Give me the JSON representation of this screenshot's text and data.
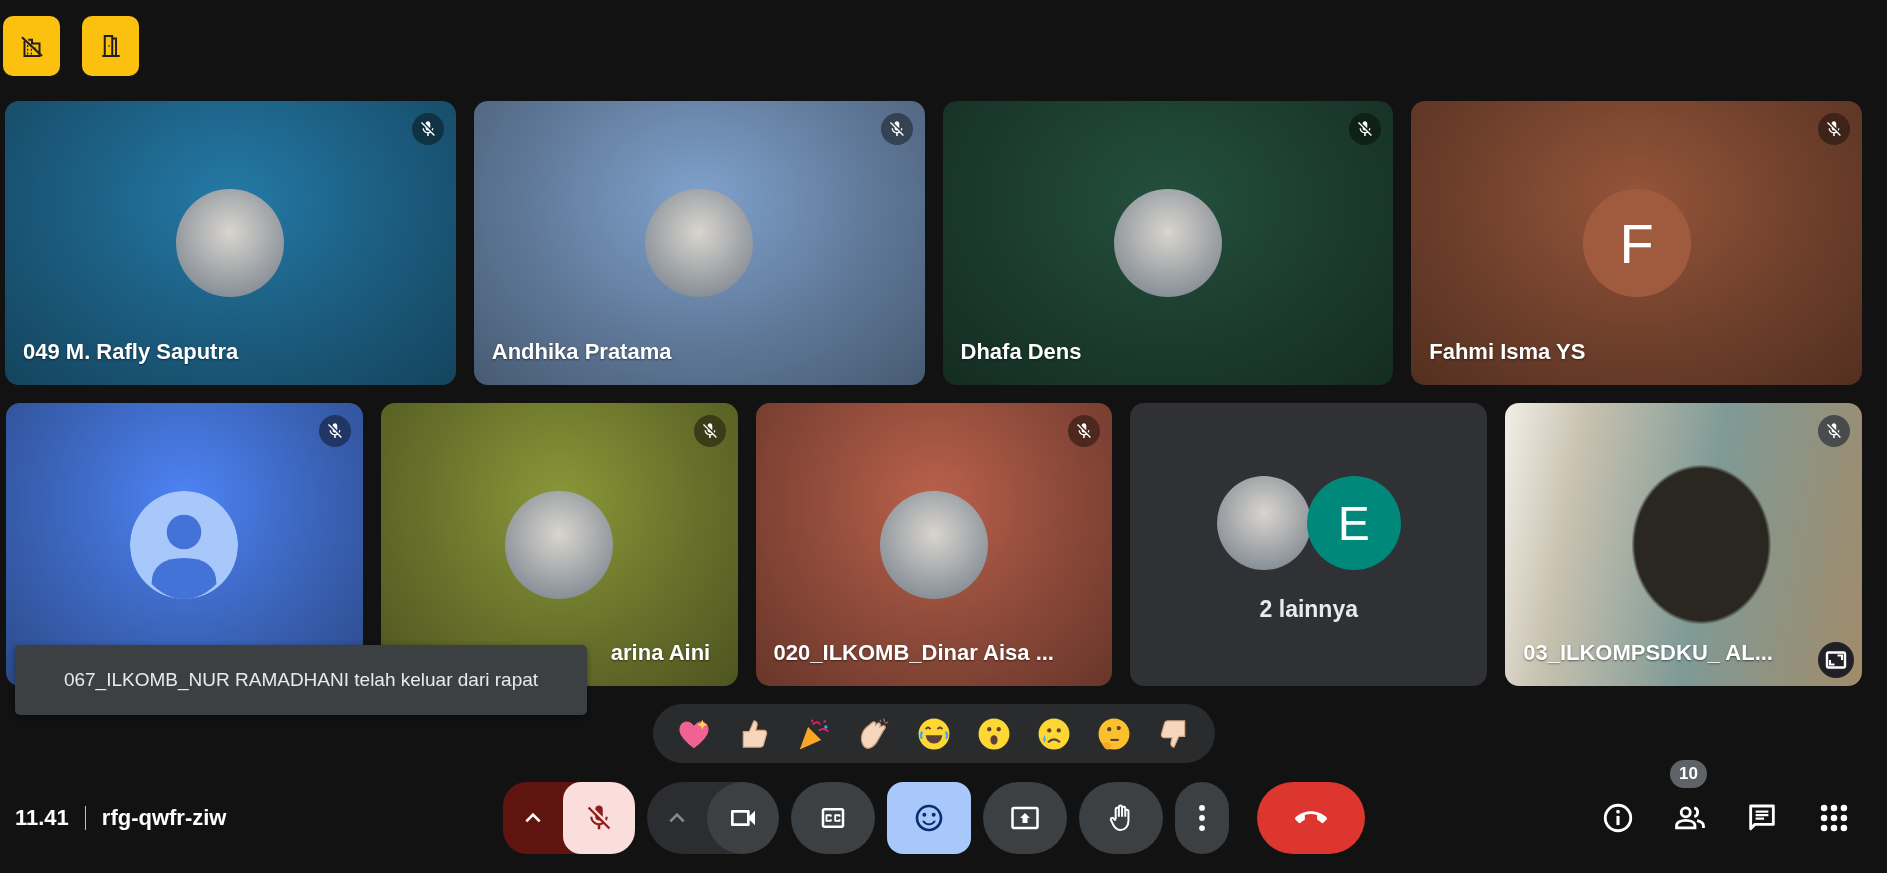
{
  "top_buttons": [
    {
      "kind": "no-building"
    },
    {
      "kind": "door"
    }
  ],
  "tiles": [
    {
      "kind": "photo",
      "name": "049 M. Rafly Saputra",
      "muted": true,
      "color": "#1b5a7c"
    },
    {
      "kind": "photo",
      "name": "Andhika Pratama",
      "muted": true,
      "color": "#5f7898"
    },
    {
      "kind": "photo",
      "name": "Dhafa Dens",
      "muted": true,
      "color": "#1b3b2d"
    },
    {
      "kind": "letter",
      "letter": "F",
      "name": "Fahmi Isma YS",
      "muted": true,
      "color": "#6e3f2b"
    },
    {
      "kind": "silhouette",
      "muted": true,
      "color": "#3a62b6"
    },
    {
      "kind": "photo",
      "name": "arina Aini",
      "covered_by_toast": true,
      "muted": true,
      "color": "#67702a"
    },
    {
      "kind": "photo",
      "name": "020_ILKOMB_Dinar Aisa ...",
      "muted": true,
      "color": "#8a4838"
    },
    {
      "kind": "others",
      "letter": "E",
      "name": "2 lainnya",
      "color": "#303134"
    },
    {
      "kind": "video",
      "name": "03_ILKOMPSDKU_ AL...",
      "muted": true
    }
  ],
  "toast": "067_ILKOMB_NUR RAMADHANI telah keluar dari rapat",
  "reactions": [
    {
      "kind": "sparkle-heart"
    },
    {
      "kind": "thumbs-up"
    },
    {
      "kind": "party"
    },
    {
      "kind": "clap"
    },
    {
      "kind": "laugh"
    },
    {
      "kind": "surprised"
    },
    {
      "kind": "sad"
    },
    {
      "kind": "thinking"
    },
    {
      "kind": "thumbs-down"
    }
  ],
  "status": {
    "time": "11.41",
    "meeting_code": "rfg-qwfr-ziw"
  },
  "controls": [
    {
      "kind": "mic",
      "muted": true
    },
    {
      "kind": "camera"
    },
    {
      "kind": "captions"
    },
    {
      "kind": "reactions",
      "selected": true
    },
    {
      "kind": "present"
    },
    {
      "kind": "hand"
    },
    {
      "kind": "more"
    },
    {
      "kind": "end-call"
    }
  ],
  "side_buttons": [
    {
      "kind": "info"
    },
    {
      "kind": "people",
      "badge": "10"
    },
    {
      "kind": "chat"
    },
    {
      "kind": "apps"
    }
  ]
}
